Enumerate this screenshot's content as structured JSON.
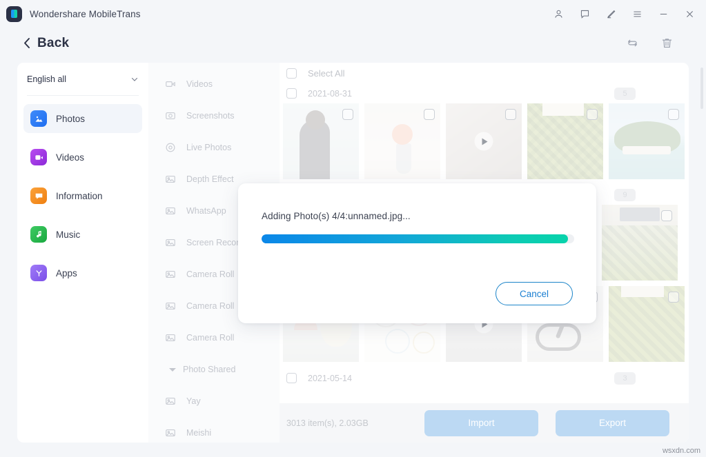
{
  "window": {
    "app_title": "Wondershare MobileTrans",
    "logo_icon": "mobiletrans-logo-icon",
    "controls": [
      {
        "name": "account-icon",
        "glyph": "person"
      },
      {
        "name": "feedback-icon",
        "glyph": "chat-bubble"
      },
      {
        "name": "edit-icon",
        "glyph": "pencil"
      },
      {
        "name": "menu-icon",
        "glyph": "hamburger"
      },
      {
        "name": "minimize-icon",
        "glyph": "minus"
      },
      {
        "name": "close-icon",
        "glyph": "cross"
      }
    ]
  },
  "backbar": {
    "label": "Back",
    "chevron_icon": "chevron-left-icon",
    "refresh_icon": "refresh-icon",
    "delete_icon": "trash-icon"
  },
  "sidebar": {
    "language": {
      "label": "English all",
      "chevron_icon": "chevron-down-icon"
    },
    "items": [
      {
        "label": "Photos",
        "icon": "photos-icon",
        "color": "#2f7df6",
        "active": true
      },
      {
        "label": "Videos",
        "icon": "videos-icon",
        "color": "#a53ae0",
        "active": false
      },
      {
        "label": "Information",
        "icon": "information-icon",
        "color": "#f08a22",
        "active": false
      },
      {
        "label": "Music",
        "icon": "music-icon",
        "color": "#2bb24c",
        "active": false
      },
      {
        "label": "Apps",
        "icon": "apps-icon",
        "color": "#8b5cf0",
        "active": false
      }
    ]
  },
  "albums": {
    "items": [
      {
        "label": "Videos",
        "icon": "video-camera-icon",
        "type": "album"
      },
      {
        "label": "Screenshots",
        "icon": "screenshot-camera-icon",
        "type": "album"
      },
      {
        "label": "Live Photos",
        "icon": "live-photo-icon",
        "type": "album"
      },
      {
        "label": "Depth Effect",
        "icon": "picture-icon",
        "type": "album"
      },
      {
        "label": "WhatsApp",
        "icon": "picture-icon",
        "type": "album"
      },
      {
        "label": "Screen Recorder",
        "icon": "picture-icon",
        "type": "album"
      },
      {
        "label": "Camera Roll",
        "icon": "picture-icon",
        "type": "album"
      },
      {
        "label": "Camera Roll",
        "icon": "picture-icon",
        "type": "album"
      },
      {
        "label": "Camera Roll",
        "icon": "picture-icon",
        "type": "album"
      },
      {
        "label": "Photo Shared",
        "icon": "triangle-down-icon",
        "type": "group"
      },
      {
        "label": "Yay",
        "icon": "picture-icon",
        "type": "album"
      },
      {
        "label": "Meishi",
        "icon": "picture-icon",
        "type": "album"
      }
    ]
  },
  "content": {
    "select_all_label": "Select All",
    "groups": [
      {
        "date": "2021-08-31",
        "count": "5",
        "thumbs": [
          {
            "name": "photo-person",
            "art": "a-person",
            "video": false
          },
          {
            "name": "photo-flowers",
            "art": "a-flowers",
            "video": false
          },
          {
            "name": "video-thumbnail",
            "art": "a-video1",
            "video": true
          },
          {
            "name": "photo-leaves",
            "art": "a-leaves",
            "video": false
          },
          {
            "name": "photo-palms",
            "art": "a-palms",
            "video": false
          }
        ]
      },
      {
        "date": "",
        "count": "9",
        "thumbs": [
          {
            "name": "photo-house-garden",
            "art": "a-house",
            "video": false
          }
        ]
      },
      {
        "date": "2021-05-14",
        "count": "3",
        "thumbs": [
          {
            "name": "photo-mushroom",
            "art": "a-mush",
            "video": false
          },
          {
            "name": "photo-infographic",
            "art": "a-info",
            "video": false
          },
          {
            "name": "video-thumbnail-2",
            "art": "a-video2",
            "video": true
          },
          {
            "name": "photo-cables",
            "art": "a-cable",
            "video": false
          }
        ]
      }
    ]
  },
  "footer": {
    "item_info": "3013 item(s), 2.03GB",
    "import_label": "Import",
    "export_label": "Export"
  },
  "dialog": {
    "message": "Adding Photo(s) 4/4:unnamed.jpg...",
    "progress_percent": 98,
    "progress_gradient_start": "#0b87e8",
    "progress_gradient_end": "#07d3ab",
    "cancel_label": "Cancel"
  },
  "watermark": {
    "text": "wsxdn.com"
  }
}
